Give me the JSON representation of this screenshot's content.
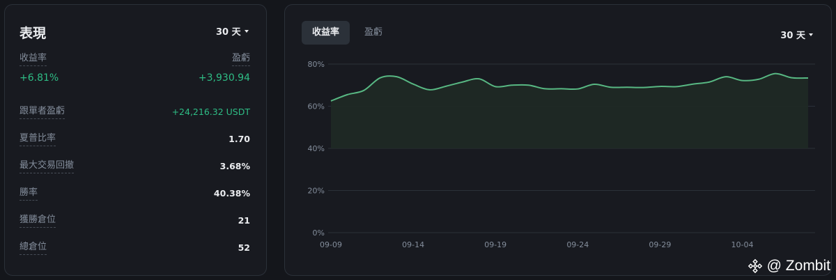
{
  "performance": {
    "title": "表現",
    "period_label": "30 天",
    "roi": {
      "label": "收益率",
      "value": "+6.81%"
    },
    "pnl": {
      "label": "盈虧",
      "value": "+3,930.94"
    },
    "stats": [
      {
        "label": "跟單者盈虧",
        "value": "+24,216.32 USDT",
        "positive": true
      },
      {
        "label": "夏普比率",
        "value": "1.70"
      },
      {
        "label": "最大交易回撤",
        "value": "3.68%"
      },
      {
        "label": "勝率",
        "value": "40.38%"
      },
      {
        "label": "獲勝倉位",
        "value": "21"
      },
      {
        "label": "總倉位",
        "value": "52"
      }
    ]
  },
  "chart_panel": {
    "tabs": [
      {
        "label": "收益率",
        "active": true
      },
      {
        "label": "盈虧",
        "active": false
      }
    ],
    "period_label": "30 天"
  },
  "chart_data": {
    "type": "area",
    "title": "",
    "xlabel": "",
    "ylabel": "",
    "y_unit": "%",
    "ylim": [
      0,
      80
    ],
    "yticks": [
      "0%",
      "20%",
      "40%",
      "60%",
      "80%"
    ],
    "xticks": [
      "09-09",
      "09-14",
      "09-19",
      "09-24",
      "09-29",
      "10-04"
    ],
    "grid": true,
    "colors": {
      "line": "#58b883",
      "fill": "#1f2a25"
    },
    "x": [
      "09-09",
      "09-10",
      "09-11",
      "09-12",
      "09-13",
      "09-14",
      "09-15",
      "09-16",
      "09-17",
      "09-18",
      "09-19",
      "09-20",
      "09-21",
      "09-22",
      "09-23",
      "09-24",
      "09-25",
      "09-26",
      "09-27",
      "09-28",
      "09-29",
      "09-30",
      "10-01",
      "10-02",
      "10-03",
      "10-04",
      "10-05",
      "10-06",
      "10-07",
      "10-08"
    ],
    "series": [
      {
        "values": [
          62.5,
          65.5,
          67.5,
          73.5,
          74.0,
          70.5,
          67.8,
          69.5,
          71.5,
          73.0,
          69.3,
          70.0,
          70.0,
          68.3,
          68.3,
          68.2,
          70.4,
          69.0,
          69.0,
          68.9,
          69.4,
          69.3,
          70.5,
          71.5,
          74.0,
          72.2,
          72.8,
          75.5,
          73.5,
          73.4
        ]
      }
    ]
  },
  "watermark": {
    "text": "@ Zombit",
    "logo_icon": "binance-logo-icon"
  }
}
